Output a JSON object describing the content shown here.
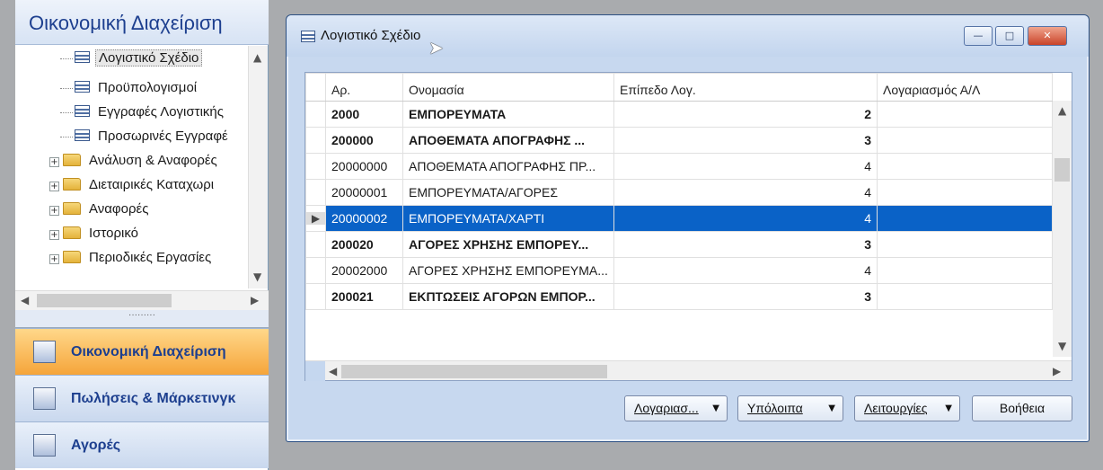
{
  "nav": {
    "title": "Οικονομική Διαχείριση",
    "tree": [
      {
        "label": "Λογιστικό Σχέδιο",
        "type": "document",
        "selected": true
      },
      {
        "label": "Προϋπολογισμοί",
        "type": "document"
      },
      {
        "label": "Εγγραφές Λογιστικής",
        "type": "document"
      },
      {
        "label": "Προσωρινές Εγγραφέ",
        "type": "document"
      },
      {
        "label": "Ανάλυση & Αναφορές",
        "type": "folder"
      },
      {
        "label": "Διεταιρικές Καταχωρι",
        "type": "folder"
      },
      {
        "label": "Αναφορές",
        "type": "folder"
      },
      {
        "label": "Ιστορικό",
        "type": "folder"
      },
      {
        "label": "Περιοδικές Εργασίες",
        "type": "folder"
      }
    ],
    "splitter_dots": "·········",
    "buttons": [
      {
        "label": "Οικονομική Διαχείριση",
        "active": true
      },
      {
        "label": "Πωλήσεις & Μάρκετινγκ",
        "active": false
      },
      {
        "label": "Αγορές",
        "active": false
      }
    ]
  },
  "window": {
    "title": "Λογιστικό Σχέδιο",
    "minimize": "—",
    "maximize": "□",
    "close": "✕"
  },
  "grid": {
    "columns": [
      "Αρ.",
      "Ονομασία",
      "Επίπεδο Λογ.",
      "Λογαριασμός Α/Λ"
    ],
    "rows": [
      {
        "no": "2000",
        "name": "ΕΜΠΟΡΕΥΜΑΤΑ",
        "level": "2",
        "account": "",
        "bold": true,
        "active": false
      },
      {
        "no": "200000",
        "name": "ΑΠΟΘΕΜΑΤΑ ΑΠΟΓΡΑΦΗΣ ...",
        "level": "3",
        "account": "",
        "bold": true,
        "active": false
      },
      {
        "no": "20000000",
        "name": "ΑΠΟΘΕΜΑΤΑ ΑΠΟΓΡΑΦΗΣ ΠΡ...",
        "level": "4",
        "account": "",
        "bold": false,
        "active": false
      },
      {
        "no": "20000001",
        "name": "ΕΜΠΟΡΕΥΜΑΤΑ/ΑΓΟΡΕΣ",
        "level": "4",
        "account": "",
        "bold": false,
        "active": false
      },
      {
        "no": "20000002",
        "name": "ΕΜΠΟΡΕΥΜΑΤΑ/ΧΑΡΤΙ",
        "level": "4",
        "account": "",
        "bold": false,
        "active": true
      },
      {
        "no": "200020",
        "name": "ΑΓΟΡΕΣ ΧΡΗΣΗΣ ΕΜΠΟΡΕΥ...",
        "level": "3",
        "account": "",
        "bold": true,
        "active": false
      },
      {
        "no": "20002000",
        "name": "ΑΓΟΡΕΣ ΧΡΗΣΗΣ ΕΜΠΟΡΕΥΜΑ...",
        "level": "4",
        "account": "",
        "bold": false,
        "active": false
      },
      {
        "no": "200021",
        "name": "ΕΚΠΤΩΣΕΙΣ ΑΓΟΡΩΝ ΕΜΠΟΡ...",
        "level": "3",
        "account": "",
        "bold": true,
        "active": false
      }
    ]
  },
  "actions": {
    "account_label": "Λογαριασ...",
    "balances_label": "Υπόλοιπα",
    "functions_label": "Λειτουργίες",
    "help_label": "Βοήθεια"
  },
  "colors": {
    "selection": "#0a62c7",
    "nav_active": "#f5a53a",
    "nav_title": "#1d3f8f"
  }
}
